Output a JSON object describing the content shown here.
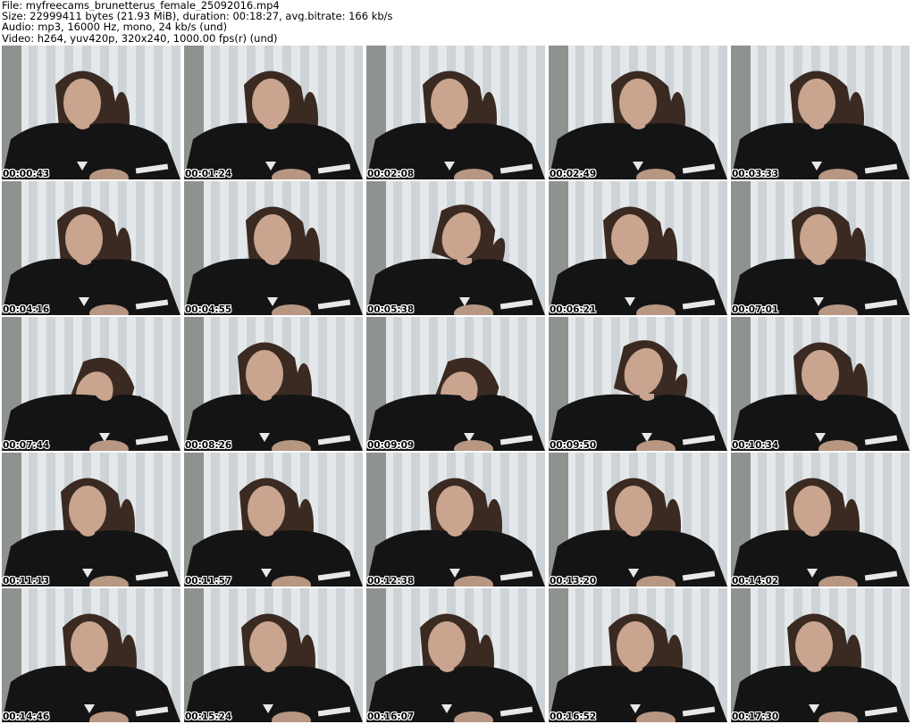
{
  "header": {
    "file_line": "File: myfreecams_brunetterus_female_25092016.mp4",
    "size_line": "Size: 22999411 bytes (21.93 MiB), duration: 00:18:27, avg.bitrate: 166 kb/s",
    "audio_line": "Audio: mp3, 16000 Hz, mono, 24 kb/s (und)",
    "video_line": "Video: h264, yuv420p, 320x240, 1000.00 fps(r) (und)"
  },
  "colors": {
    "curtain": "#e4e8ea",
    "curtain_shadow": "#b9c1c6",
    "hair": "#3a2a22",
    "skin": "#c9a48e",
    "top": "#141414",
    "stripe": "#e8e8e8",
    "wall_left": "#6b6f68"
  },
  "thumbnails": [
    {
      "timestamp": "00:00:43",
      "pose": "center",
      "thumb_icon": "video-frame-icon"
    },
    {
      "timestamp": "00:01:24",
      "pose": "center",
      "thumb_icon": "video-frame-icon"
    },
    {
      "timestamp": "00:02:08",
      "pose": "center",
      "thumb_icon": "video-frame-icon"
    },
    {
      "timestamp": "00:02:49",
      "pose": "center",
      "thumb_icon": "video-frame-icon"
    },
    {
      "timestamp": "00:03:33",
      "pose": "center",
      "thumb_icon": "video-frame-icon"
    },
    {
      "timestamp": "00:04:16",
      "pose": "center",
      "thumb_icon": "video-frame-icon"
    },
    {
      "timestamp": "00:04:55",
      "pose": "center",
      "thumb_icon": "video-frame-icon"
    },
    {
      "timestamp": "00:05:38",
      "pose": "turned",
      "thumb_icon": "video-frame-icon"
    },
    {
      "timestamp": "00:06:21",
      "pose": "center",
      "thumb_icon": "video-frame-icon"
    },
    {
      "timestamp": "00:07:01",
      "pose": "center",
      "thumb_icon": "video-frame-icon"
    },
    {
      "timestamp": "00:07:44",
      "pose": "down",
      "thumb_icon": "video-frame-icon"
    },
    {
      "timestamp": "00:08:26",
      "pose": "center",
      "thumb_icon": "video-frame-icon"
    },
    {
      "timestamp": "00:09:09",
      "pose": "down",
      "thumb_icon": "video-frame-icon"
    },
    {
      "timestamp": "00:09:50",
      "pose": "turned",
      "thumb_icon": "video-frame-icon"
    },
    {
      "timestamp": "00:10:34",
      "pose": "center",
      "thumb_icon": "video-frame-icon"
    },
    {
      "timestamp": "00:11:13",
      "pose": "center",
      "thumb_icon": "video-frame-icon"
    },
    {
      "timestamp": "00:11:57",
      "pose": "center",
      "thumb_icon": "video-frame-icon"
    },
    {
      "timestamp": "00:12:38",
      "pose": "center",
      "thumb_icon": "video-frame-icon"
    },
    {
      "timestamp": "00:13:20",
      "pose": "center",
      "thumb_icon": "video-frame-icon"
    },
    {
      "timestamp": "00:14:02",
      "pose": "center",
      "thumb_icon": "video-frame-icon"
    },
    {
      "timestamp": "00:14:46",
      "pose": "center",
      "thumb_icon": "video-frame-icon"
    },
    {
      "timestamp": "00:15:24",
      "pose": "center",
      "thumb_icon": "video-frame-icon"
    },
    {
      "timestamp": "00:16:07",
      "pose": "center",
      "thumb_icon": "video-frame-icon"
    },
    {
      "timestamp": "00:16:52",
      "pose": "center",
      "thumb_icon": "video-frame-icon"
    },
    {
      "timestamp": "00:17:30",
      "pose": "center",
      "thumb_icon": "video-frame-icon"
    }
  ]
}
